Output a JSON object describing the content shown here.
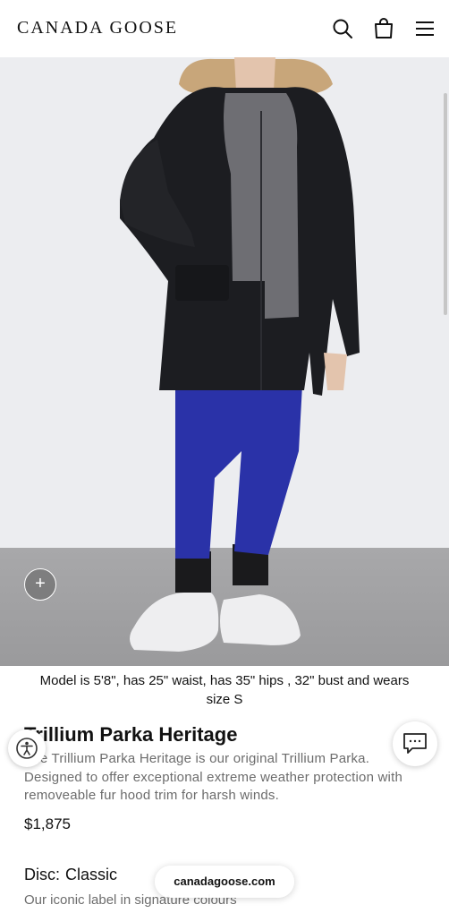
{
  "header": {
    "logo": "CANADA GOOSE",
    "icons": [
      "search-icon",
      "shopping-bag-icon",
      "menu-icon"
    ]
  },
  "hero": {
    "zoom_icon": "+"
  },
  "product": {
    "model_note": "Model is 5'8\", has 25\" waist, has 35\" hips , 32\" bust and wears size S",
    "title": "Trillium Parka Heritage",
    "description": "The Trillium Parka Heritage is our original Trillium Parka. Designed to offer exceptional extreme weather protection with removeable fur hood trim for harsh winds.",
    "price": "$1,875",
    "disc_label": "Disc:",
    "disc_value": "Classic",
    "disc_description": "Our iconic label in signature colours"
  },
  "browser": {
    "url": "canadagoose.com"
  },
  "colors": {
    "background": "#ffffff",
    "hero_bg": "#ecedf0",
    "text": "#111111",
    "muted": "#6c6c6c",
    "parka": "#1c1d21",
    "leggings": "#2a32a8"
  }
}
